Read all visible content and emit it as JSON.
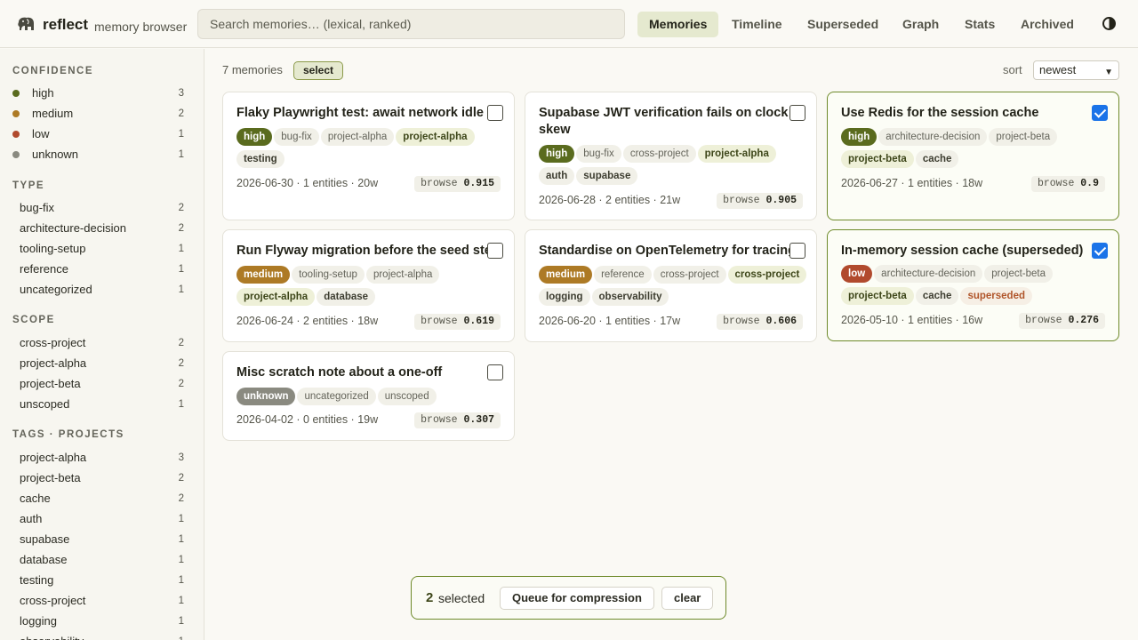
{
  "app": {
    "brand": "reflect",
    "subtitle": "memory browser",
    "logo_icon": "elephant-icon",
    "search_placeholder": "Search memories… (lexical, ranked)",
    "nav": [
      "Memories",
      "Timeline",
      "Superseded",
      "Graph",
      "Stats",
      "Archived"
    ],
    "nav_active": "Memories",
    "theme_icon": "contrast-icon"
  },
  "colors": {
    "high": "#5a6b1e",
    "medium": "#ad7a25",
    "low": "#b14a2d",
    "unknown": "#8a8a80",
    "accent": "#6e8a2a"
  },
  "sidebar": {
    "confidence": {
      "heading": "CONFIDENCE",
      "items": [
        {
          "label": "high",
          "count": "3"
        },
        {
          "label": "medium",
          "count": "2"
        },
        {
          "label": "low",
          "count": "1"
        },
        {
          "label": "unknown",
          "count": "1"
        }
      ]
    },
    "type": {
      "heading": "TYPE",
      "items": [
        {
          "label": "bug-fix",
          "count": "2"
        },
        {
          "label": "architecture-decision",
          "count": "2"
        },
        {
          "label": "tooling-setup",
          "count": "1"
        },
        {
          "label": "reference",
          "count": "1"
        },
        {
          "label": "uncategorized",
          "count": "1"
        }
      ]
    },
    "scope": {
      "heading": "SCOPE",
      "items": [
        {
          "label": "cross-project",
          "count": "2"
        },
        {
          "label": "project-alpha",
          "count": "2"
        },
        {
          "label": "project-beta",
          "count": "2"
        },
        {
          "label": "unscoped",
          "count": "1"
        }
      ]
    },
    "tags": {
      "heading": "TAGS · PROJECTS",
      "items": [
        {
          "label": "project-alpha",
          "count": "3"
        },
        {
          "label": "project-beta",
          "count": "2"
        },
        {
          "label": "cache",
          "count": "2"
        },
        {
          "label": "auth",
          "count": "1"
        },
        {
          "label": "supabase",
          "count": "1"
        },
        {
          "label": "database",
          "count": "1"
        },
        {
          "label": "testing",
          "count": "1"
        },
        {
          "label": "cross-project",
          "count": "1"
        },
        {
          "label": "logging",
          "count": "1"
        },
        {
          "label": "observability",
          "count": "1"
        }
      ]
    }
  },
  "main": {
    "count_label": "7 memories",
    "select_label": "select",
    "sort_label": "sort",
    "sort_value": "newest"
  },
  "cards": [
    {
      "title": "Flaky Playwright test: await network idle",
      "checked": false,
      "confidence": "high",
      "tags": [
        {
          "label": "bug-fix",
          "kind": "plain"
        },
        {
          "label": "project-alpha",
          "kind": "plain"
        },
        {
          "label": "project-alpha",
          "kind": "project"
        },
        {
          "label": "testing",
          "kind": "topic"
        }
      ],
      "meta": "2026-06-30 · 1 entities · 20w",
      "score_label": "browse",
      "score": "0.915"
    },
    {
      "title": "Supabase JWT verification fails on clock skew",
      "checked": false,
      "confidence": "high",
      "tags": [
        {
          "label": "bug-fix",
          "kind": "plain"
        },
        {
          "label": "cross-project",
          "kind": "plain"
        },
        {
          "label": "project-alpha",
          "kind": "project"
        },
        {
          "label": "auth",
          "kind": "topic"
        },
        {
          "label": "supabase",
          "kind": "topic"
        }
      ],
      "meta": "2026-06-28 · 2 entities · 21w",
      "score_label": "browse",
      "score": "0.905"
    },
    {
      "title": "Use Redis for the session cache",
      "checked": true,
      "confidence": "high",
      "tags": [
        {
          "label": "architecture-decision",
          "kind": "plain"
        },
        {
          "label": "project-beta",
          "kind": "plain"
        },
        {
          "label": "project-beta",
          "kind": "project"
        },
        {
          "label": "cache",
          "kind": "topic"
        }
      ],
      "meta": "2026-06-27 · 1 entities · 18w",
      "score_label": "browse",
      "score": "0.9"
    },
    {
      "title": "Run Flyway migration before the seed step",
      "checked": false,
      "confidence": "medium",
      "tags": [
        {
          "label": "tooling-setup",
          "kind": "plain"
        },
        {
          "label": "project-alpha",
          "kind": "plain"
        },
        {
          "label": "project-alpha",
          "kind": "project"
        },
        {
          "label": "database",
          "kind": "topic"
        }
      ],
      "meta": "2026-06-24 · 2 entities · 18w",
      "score_label": "browse",
      "score": "0.619"
    },
    {
      "title": "Standardise on OpenTelemetry for tracing",
      "checked": false,
      "confidence": "medium",
      "tags": [
        {
          "label": "reference",
          "kind": "plain"
        },
        {
          "label": "cross-project",
          "kind": "plain"
        },
        {
          "label": "cross-project",
          "kind": "project"
        },
        {
          "label": "logging",
          "kind": "topic"
        },
        {
          "label": "observability",
          "kind": "topic"
        }
      ],
      "meta": "2026-06-20 · 1 entities · 17w",
      "score_label": "browse",
      "score": "0.606"
    },
    {
      "title": "In-memory session cache (superseded)",
      "checked": true,
      "confidence": "low",
      "tags": [
        {
          "label": "architecture-decision",
          "kind": "plain"
        },
        {
          "label": "project-beta",
          "kind": "plain"
        },
        {
          "label": "project-beta",
          "kind": "project"
        },
        {
          "label": "cache",
          "kind": "topic"
        },
        {
          "label": "superseded",
          "kind": "sup"
        }
      ],
      "meta": "2026-05-10 · 1 entities · 16w",
      "score_label": "browse",
      "score": "0.276"
    },
    {
      "title": "Misc scratch note about a one-off",
      "checked": false,
      "confidence": "unknown",
      "tags": [
        {
          "label": "uncategorized",
          "kind": "plain"
        },
        {
          "label": "unscoped",
          "kind": "plain"
        }
      ],
      "meta": "2026-04-02 · 0 entities · 19w",
      "score_label": "browse",
      "score": "0.307"
    }
  ],
  "selection_bar": {
    "count": "2",
    "text": "selected",
    "queue_label": "Queue for compression",
    "clear_label": "clear"
  }
}
